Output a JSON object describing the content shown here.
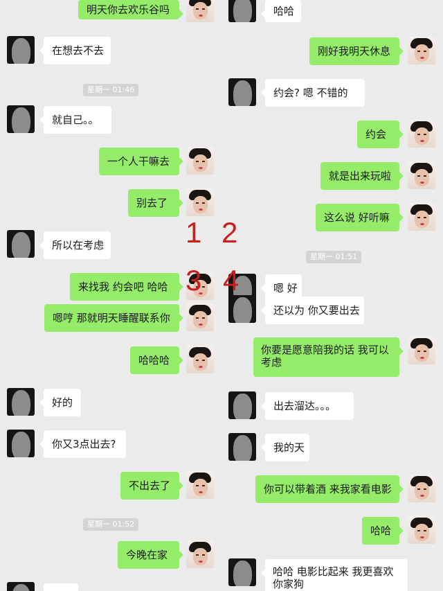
{
  "panels": {
    "p1": {
      "messages": [
        {
          "side": "me",
          "text": "明天你去欢乐谷吗"
        },
        {
          "side": "other",
          "text": "在想去不去"
        },
        {
          "side": "time",
          "text": "星期一 01:46"
        },
        {
          "side": "other",
          "text": "就自己。。"
        },
        {
          "side": "me",
          "text": "一个人干嘛去"
        },
        {
          "side": "me",
          "text": "别去了"
        },
        {
          "side": "other",
          "text": "所以在考虑"
        }
      ]
    },
    "p2": {
      "messages": [
        {
          "side": "other",
          "text": "哈哈"
        },
        {
          "side": "me",
          "text": "刚好我明天休息"
        },
        {
          "side": "other",
          "text": "约会? 嗯 不错的"
        },
        {
          "side": "me",
          "text": "约会"
        },
        {
          "side": "me",
          "text": "就是出来玩啦"
        },
        {
          "side": "me",
          "text": "这么说 好听嘛"
        }
      ]
    },
    "p3": {
      "messages": [
        {
          "side": "me",
          "text": "来找我 约会吧 哈哈"
        },
        {
          "side": "me",
          "text": "嗯哼 那就明天睡醒联系你"
        },
        {
          "side": "me",
          "text": "哈哈哈"
        },
        {
          "side": "other",
          "text": "好的"
        },
        {
          "side": "other",
          "text": "你又3点出去?"
        },
        {
          "side": "me",
          "text": "不出去了"
        },
        {
          "side": "time",
          "text": "星期一 01:52"
        },
        {
          "side": "me",
          "text": "今晚在家"
        }
      ]
    },
    "p4": {
      "messages": [
        {
          "side": "time",
          "text": "星期一 01:51"
        },
        {
          "side": "other",
          "text": "嗯 好"
        },
        {
          "side": "other",
          "text": "还以为 你又要出去"
        },
        {
          "side": "me",
          "text": "你要是愿意陪我的话 我可以考虑"
        },
        {
          "side": "other",
          "text": "出去溜达。。。"
        },
        {
          "side": "other",
          "text": "我的天"
        },
        {
          "side": "me",
          "text": "你可以带着酒 来我家看电影"
        },
        {
          "side": "me",
          "text": "哈哈"
        },
        {
          "side": "other",
          "text": "哈哈 电影比起来 我更喜欢你家狗"
        }
      ]
    }
  },
  "markers": [
    "1",
    "2",
    "3",
    "4"
  ],
  "colors": {
    "background": "#ebebeb",
    "sent_bubble": "#95ec69",
    "received_bubble": "#ffffff",
    "marker": "#c81e1e"
  }
}
